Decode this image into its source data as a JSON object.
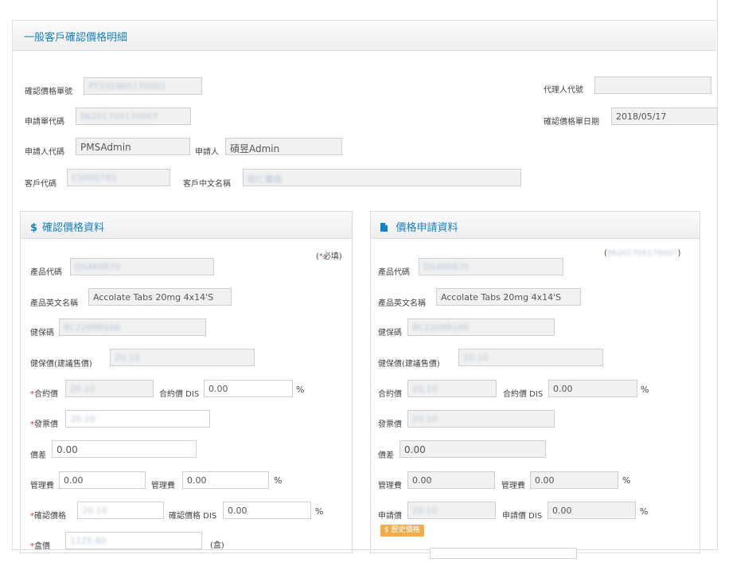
{
  "page": {
    "title": "一般客戶確認價格明細"
  },
  "header_fields": {
    "confirm_no_label": "確認價格單號",
    "confirm_no_value": "PT201805170001",
    "agent_code_label": "代理人代號",
    "agent_code_value": "",
    "apply_no_label": "申請單代碼",
    "apply_no_value": "PA201705170007",
    "confirm_date_label": "確認價格單日期",
    "confirm_date_value": "2018/05/17",
    "applicant_code_label": "申請人代碼",
    "applicant_code_value": "PMSAdmin",
    "applicant_label": "申請人",
    "applicant_value": "碩昱Admin",
    "customer_code_label": "客戶代碼",
    "customer_code_value": "CS000781",
    "customer_name_label": "客戶中文名稱",
    "customer_name_value": "和仁藥局"
  },
  "left_panel": {
    "icon": "dollar-icon",
    "icon_glyph": "$",
    "title": "確認價格資料",
    "required_prefix": "(",
    "required_star": "*",
    "required_text": "必填)",
    "product_code_label": "產品代碼",
    "product_code_value": "DS460870",
    "product_en_name_label": "產品英文名稱",
    "product_en_name_value": "Accolate Tabs 20mg 4x14'S",
    "nhi_code_label": "健保碼",
    "nhi_code_value": "BC22098100",
    "nhi_price_label": "健保價(建議售價)",
    "nhi_price_value": "20.10",
    "contract_price_label": "合約價",
    "contract_price_value": "20.10",
    "contract_dis_label": "合約價 DIS",
    "contract_dis_value": "0.00",
    "invoice_price_label": "發票價",
    "invoice_price_value": "20.10",
    "price_diff_label": "價差",
    "price_diff_value": "0.00",
    "mgmt_fee_label": "管理費",
    "mgmt_fee_value": "0.00",
    "mgmt_fee2_label": "管理費",
    "mgmt_fee2_value": "0.00",
    "confirm_price_label": "確認價格",
    "confirm_price_value": "20.10",
    "confirm_dis_label": "確認價格 DIS",
    "confirm_dis_value": "0.00",
    "box_price_label": "盒價",
    "box_price_value": "1125.60",
    "box_unit": "(盒)",
    "pct": "%"
  },
  "right_panel": {
    "icon": "document-icon",
    "title": "價格申請資料",
    "ref_open": "(",
    "ref_value": "PA201705170007",
    "ref_close": ")",
    "product_code_label": "產品代碼",
    "product_code_value": "DS460870",
    "product_en_name_label": "產品英文名稱",
    "product_en_name_value": "Accolate Tabs 20mg 4x14'S",
    "nhi_code_label": "健保碼",
    "nhi_code_value": "BC22098100",
    "nhi_price_label": "健保價(建議售價)",
    "nhi_price_value": "20.10",
    "contract_price_label": "合約價",
    "contract_price_value": "20.10",
    "contract_dis_label": "合約價 DIS",
    "contract_dis_value": "0.00",
    "invoice_price_label": "發票價",
    "invoice_price_value": "20.10",
    "price_diff_label": "價差",
    "price_diff_value": "0.00",
    "mgmt_fee_label": "管理費",
    "mgmt_fee_value": "0.00",
    "mgmt_fee2_label": "管理費",
    "mgmt_fee2_value": "0.00",
    "apply_price_label": "申請價",
    "apply_price_value": "20.10",
    "apply_dis_label": "申請價 DIS",
    "apply_dis_value": "0.00",
    "history_button": "$ 歷史價格",
    "pct": "%"
  }
}
